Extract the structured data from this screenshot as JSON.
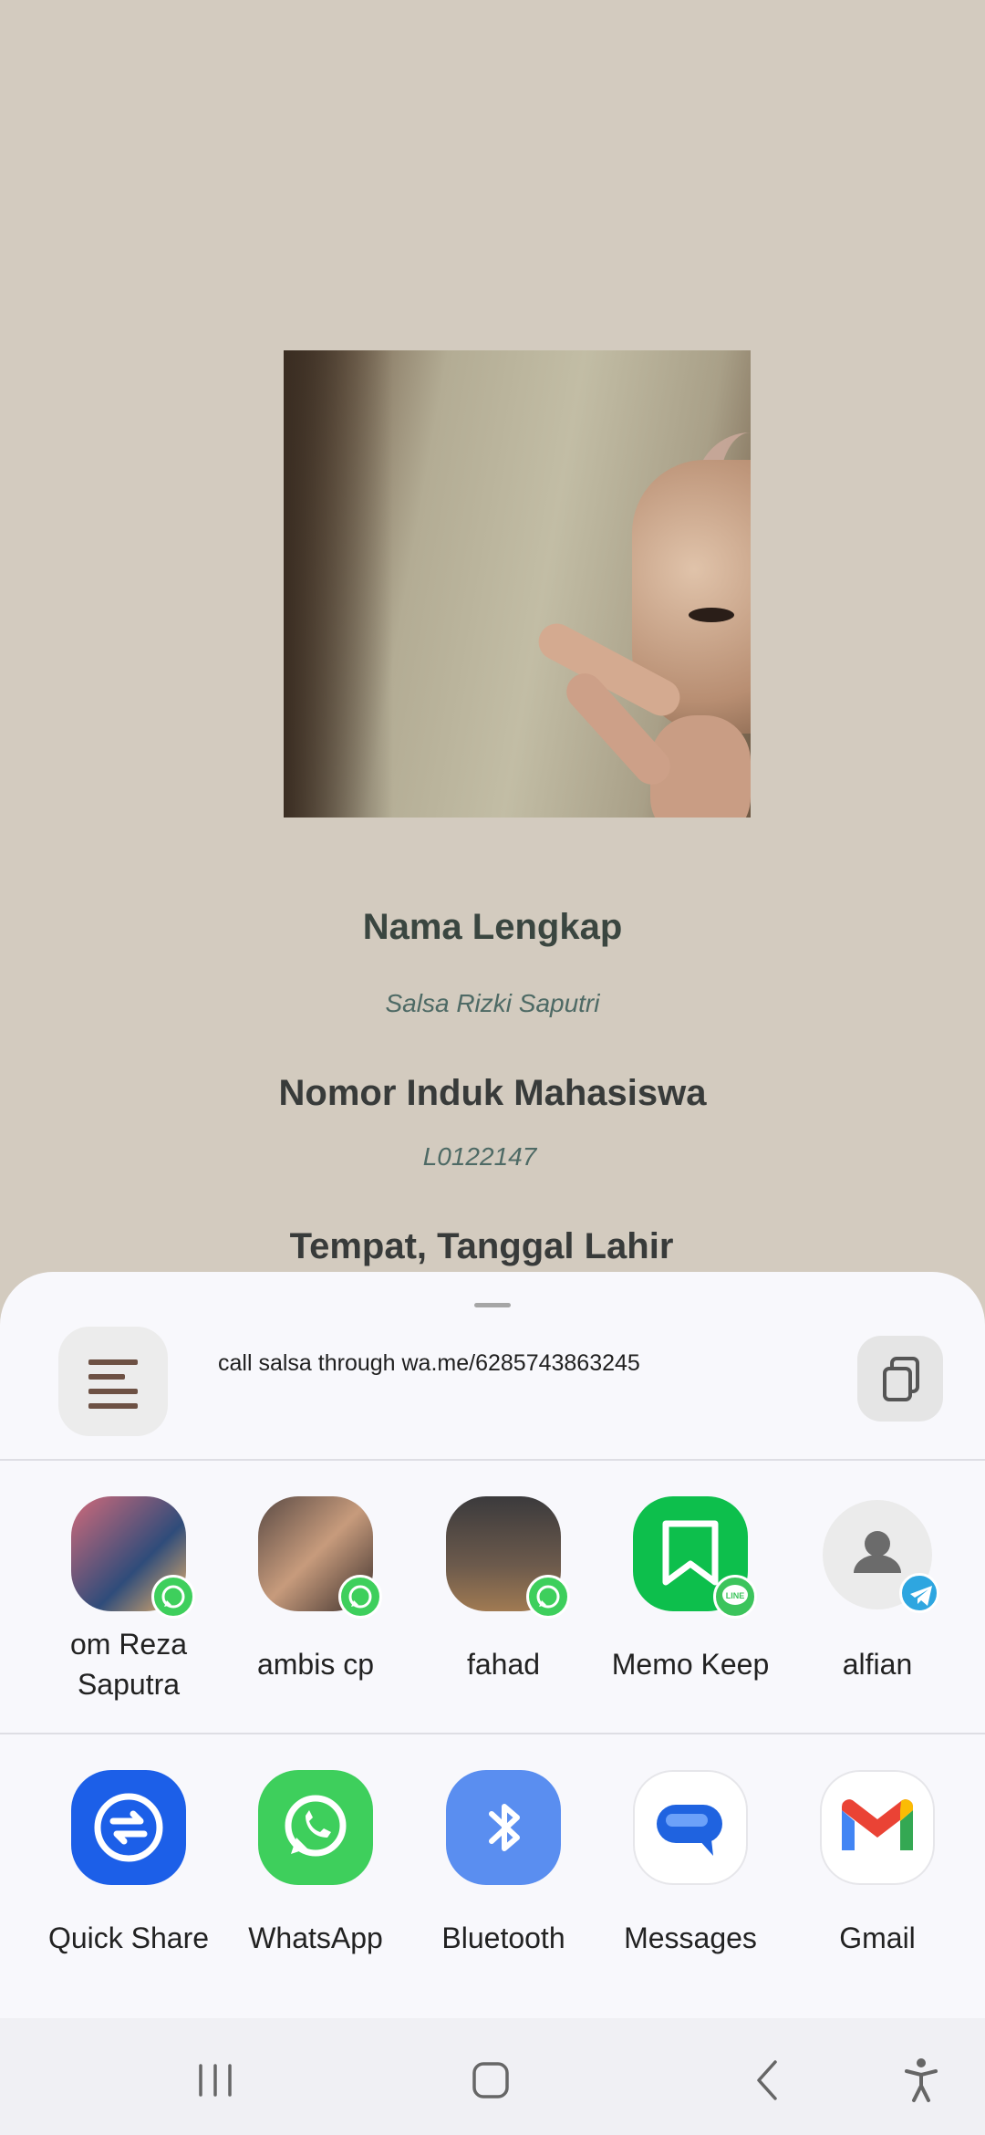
{
  "profile": {
    "name_label": "Nama Lengkap",
    "name_value": "Salsa Rizki Saputri",
    "nim_label": "Nomor Induk Mahasiswa",
    "nim_value": "L0122147",
    "birth_label": "Tempat, Tanggal Lahir"
  },
  "share": {
    "text": "call salsa through wa.me/6285743863245",
    "contacts": [
      {
        "name": "om Reza Saputra",
        "icon": "avatar-photo",
        "badge": "whatsapp-icon"
      },
      {
        "name": "ambis cp",
        "icon": "avatar-photo",
        "badge": "whatsapp-icon"
      },
      {
        "name": "fahad",
        "icon": "avatar-photo",
        "badge": "whatsapp-icon"
      },
      {
        "name": "Memo Keep",
        "icon": "bookmark-icon",
        "badge": "line-icon"
      },
      {
        "name": "alfian",
        "icon": "person-icon",
        "badge": "telegram-icon"
      }
    ],
    "apps": [
      {
        "name": "Quick Share",
        "icon": "quick-share-icon",
        "color": "#1c5fe8"
      },
      {
        "name": "WhatsApp",
        "icon": "whatsapp-icon",
        "color": "#3ecf5c"
      },
      {
        "name": "Bluetooth",
        "icon": "bluetooth-icon",
        "color": "#5a8ef0"
      },
      {
        "name": "Messages",
        "icon": "messages-icon",
        "color": "#1f63e0"
      },
      {
        "name": "Gmail",
        "icon": "gmail-icon",
        "color": "#ea4335"
      }
    ]
  },
  "navbar": {
    "items": [
      "recents-icon",
      "home-icon",
      "back-icon",
      "accessibility-icon"
    ]
  }
}
